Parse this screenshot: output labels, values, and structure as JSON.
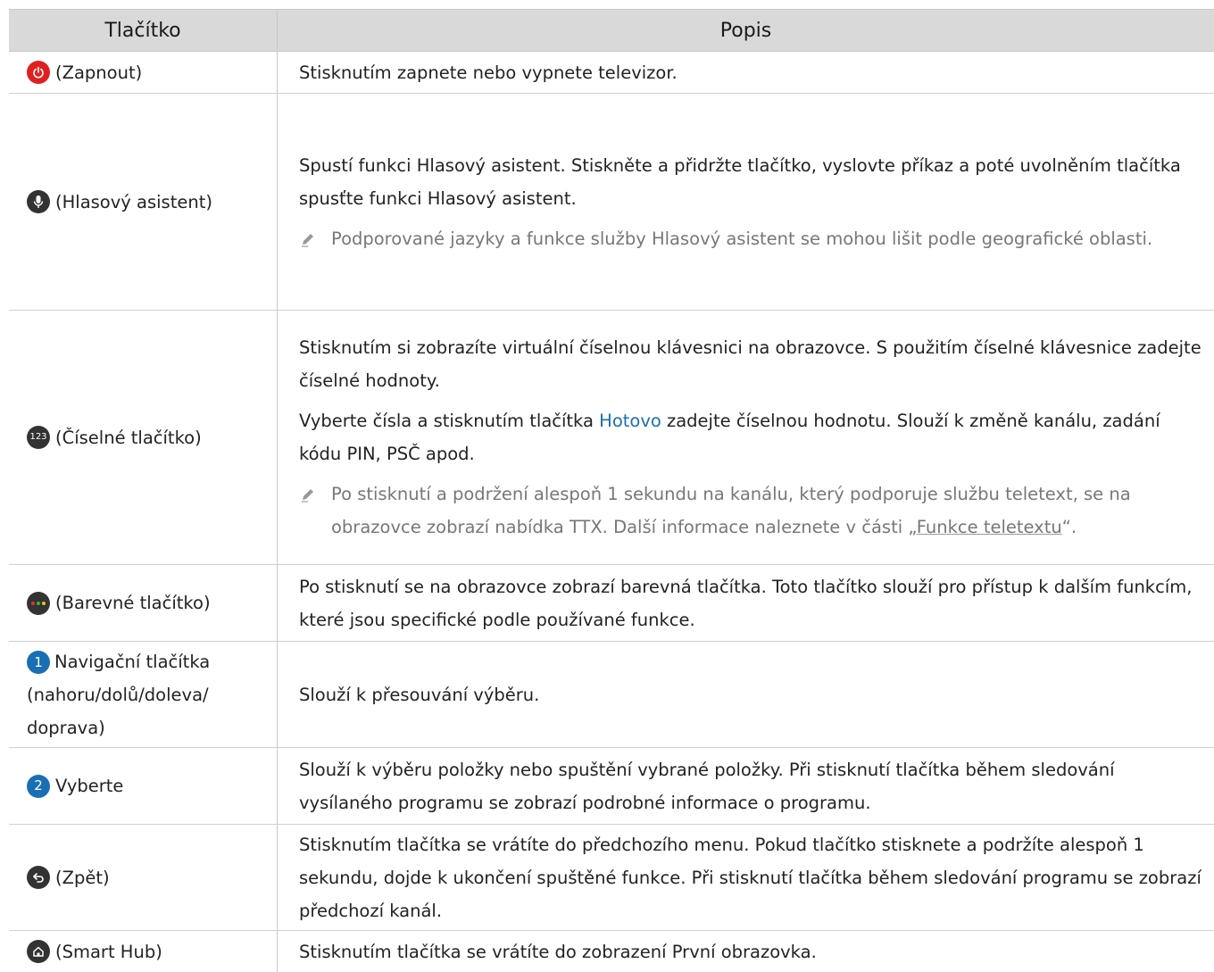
{
  "header": {
    "col1": "Tlačítko",
    "col2": "Popis"
  },
  "rows": [
    {
      "button": "(Zapnout)",
      "icon": "power-icon",
      "desc": "Stisknutím zapnete nebo vypnete televizor."
    },
    {
      "button": "(Hlasový asistent)",
      "icon": "microphone-icon",
      "desc": "Spustí funkci Hlasový asistent. Stiskněte a přidržte tlačítko, vyslovte příkaz a poté uvolněním tlačítka spusťte funkci Hlasový asistent.",
      "note": "Podporované jazyky a funkce služby Hlasový asistent se mohou lišit podle geografické oblasti."
    },
    {
      "button": "(Číselné tlačítko)",
      "icon": "number-123-icon",
      "icon_text": "123",
      "desc1": "Stisknutím si zobrazíte virtuální číselnou klávesnici na obrazovce. S použitím číselné klávesnice zadejte číselné hodnoty.",
      "desc2_pre": "Vyberte čísla a stisknutím tlačítka ",
      "desc2_hl": "Hotovo",
      "desc2_post": " zadejte číselnou hodnotu. Slouží k změně kanálu, zadání kódu PIN, PSČ apod.",
      "note_pre": "Po stisknutí a podržení alespoň 1 sekundu na kanálu, který podporuje službu teletext, se na obrazovce zobrazí nabídka TTX. Další informace naleznete v části „",
      "note_link": "Funkce teletextu",
      "note_post": "“."
    },
    {
      "button": "(Barevné tlačítko)",
      "icon": "color-dots-icon",
      "desc": "Po stisknutí se na obrazovce zobrazí barevná tlačítka. Toto tlačítko slouží pro přístup k dalším funkcím, které jsou specifické podle používané funkce."
    },
    {
      "badge": "1",
      "button": "Navigační tlačítka (nahoru/dolů/doleva/doprava)",
      "button_l1": "Navigační tlačítka",
      "button_l2": "(nahoru/dolů/doleva/",
      "button_l3": "doprava)",
      "desc": "Slouží k přesouvání výběru."
    },
    {
      "badge": "2",
      "button": "Vyberte",
      "desc": "Slouží k výběru položky nebo spuštění vybrané položky. Při stisknutí tlačítka během sledování vysílaného programu se zobrazí podrobné informace o programu."
    },
    {
      "button": "(Zpět)",
      "icon": "back-arrow-icon",
      "desc": "Stisknutím tlačítka se vrátíte do předchozího menu. Pokud tlačítko stisknete a podržíte alespoň 1 sekundu, dojde k ukončení spuštěné funkce. Při stisknutí tlačítka během sledování programu se zobrazí předchozí kanál."
    },
    {
      "button": "(Smart Hub)",
      "icon": "home-icon",
      "desc": "Stisknutím tlačítka se vrátíte do zobrazení První obrazovka."
    }
  ],
  "colors": {
    "header_bg": "#d9d9d9",
    "power_red": "#e02020",
    "badge_blue": "#1a6fb4",
    "highlight": "#1a6fb4",
    "note_gray": "#777777"
  }
}
